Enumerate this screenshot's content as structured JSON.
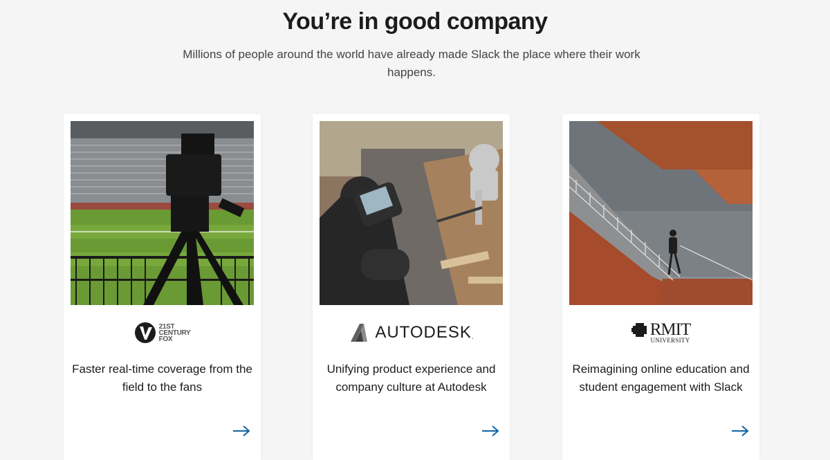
{
  "section": {
    "title": "You’re in good company",
    "subtitle": "Millions of people around the world have already made Slack the place where their work happens."
  },
  "cards": [
    {
      "logo": "21st Century Fox",
      "logo_lines": [
        "21ST",
        "CENTURY",
        "FOX"
      ],
      "text": "Faster real-time coverage from the field to the fans",
      "image": "tv-camera-in-stadium-photo",
      "arrow_icon": "arrow-right-icon"
    },
    {
      "logo": "AUTODESK",
      "logo_mark": ".",
      "text": "Unifying product experience and company culture at Autodesk",
      "image": "engineer-with-robot-arm-photo",
      "arrow_icon": "arrow-right-icon"
    },
    {
      "logo_main": "RMIT",
      "logo_sub": "UNIVERSITY",
      "text": "Reimagining online education and student engagement with Slack",
      "image": "person-on-staircase-photo",
      "arrow_icon": "arrow-right-icon"
    }
  ],
  "colors": {
    "background": "#f5f5f5",
    "card": "#ffffff",
    "arrow": "#1264a3",
    "text": "#1d1c1d"
  }
}
